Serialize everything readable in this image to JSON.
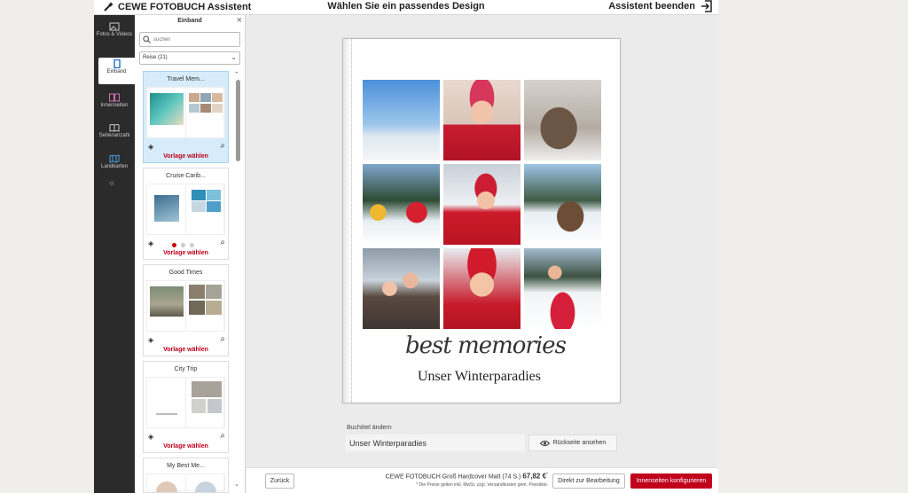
{
  "header": {
    "brand": "CEWE FOTOBUCH Assistent",
    "title": "Wählen Sie ein passendes Design",
    "exit_label": "Assistent beenden"
  },
  "nav": {
    "items": [
      {
        "label": "Fotos & Videos",
        "icon": "photos-icon"
      },
      {
        "label": "Einband",
        "icon": "cover-icon"
      },
      {
        "label": "Innenseiten",
        "icon": "inner-pages-icon"
      },
      {
        "label": "Seitenanzahl",
        "icon": "page-count-icon"
      },
      {
        "label": "Landkarten",
        "icon": "map-icon"
      }
    ],
    "active_index": 1,
    "collapse_icon": "double-chevron-left-icon"
  },
  "panel": {
    "title": "Einband",
    "search_placeholder": "suchen",
    "category": "Reise (21)",
    "templates": [
      {
        "name": "Travel Mem...",
        "action": "Vorlage wählen"
      },
      {
        "name": "Cruise Carib...",
        "action": "Vorlage wählen"
      },
      {
        "name": "Good Times",
        "action": "Vorlage wählen"
      },
      {
        "name": "City Trip",
        "action": "Vorlage wählen"
      },
      {
        "name": "My Best Me..."
      }
    ]
  },
  "book": {
    "script_text": "best memories",
    "subtitle": "Unser Winterparadies"
  },
  "title_editor": {
    "label": "Buchtitel ändern",
    "value": "Unser Winterparadies",
    "backside_label": "Rückseite ansehen"
  },
  "footer": {
    "back_label": "Zurück",
    "product": "CEWE FOTOBUCH Groß Hardcover Matt (74 S.)",
    "price": "67,82 €",
    "price_footnote": "¹",
    "price_note": "* Die Preise gelten inkl. MwSt. zzgl. Versandkosten gem. Preisliste.",
    "direct_label": "Direkt zur Bearbeitung",
    "configure_label": "Innenseiten konfigurieren"
  },
  "colors": {
    "accent": "#c0001c",
    "sidebar": "#2b2b2b",
    "selected": "#d7ecfa"
  }
}
